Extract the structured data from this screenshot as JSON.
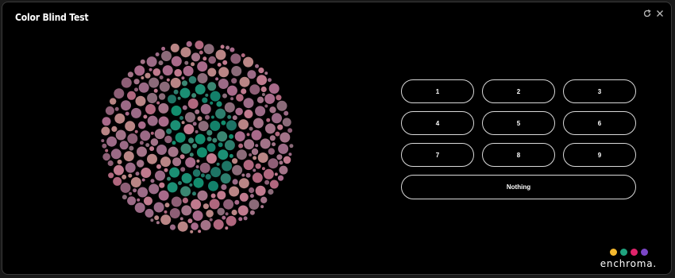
{
  "window": {
    "title": "Color Blind Test"
  },
  "controls": {
    "refresh_icon": "refresh-icon",
    "close_icon": "close-icon"
  },
  "plate": {
    "figure": "9",
    "background_colors": [
      "#b0677e",
      "#a86a8a",
      "#9b6a86",
      "#b98585",
      "#8e5f76",
      "#a37388",
      "#c07a8e",
      "#8b6b79"
    ],
    "figure_colors": [
      "#13806a",
      "#1b8f74",
      "#2d7d6d",
      "#128c6d",
      "#3a8672",
      "#1e7465"
    ]
  },
  "answers": {
    "options": [
      "1",
      "2",
      "3",
      "4",
      "5",
      "6",
      "7",
      "8",
      "9"
    ],
    "nothing_label": "Nothing"
  },
  "brand": {
    "name": "enchroma.",
    "dot_colors": [
      "#f5b82e",
      "#1fa37f",
      "#e0246b",
      "#7b46c7"
    ]
  }
}
